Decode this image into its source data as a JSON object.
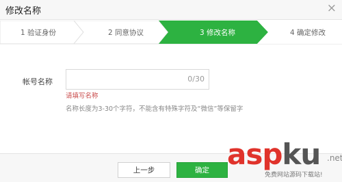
{
  "dialog": {
    "title": "修改名称",
    "close_symbol": "×"
  },
  "steps": [
    {
      "label": "1 验证身份",
      "active": false
    },
    {
      "label": "2 同意协议",
      "active": false
    },
    {
      "label": "3 修改名称",
      "active": true
    },
    {
      "label": "4 确定修改",
      "active": false
    }
  ],
  "colors": {
    "active_step": "#2db241",
    "error": "#c94a4a",
    "primary_button": "#2db241"
  },
  "form": {
    "label": "帐号名称",
    "value": "",
    "counter": "0/30",
    "error": "请填写名称",
    "hint": "名称长度为3-30个字符，不能含有特殊字符及“微信”等保留字"
  },
  "buttons": {
    "prev": "上一步",
    "ok": "确定"
  },
  "watermark": {
    "brand_red": "asp",
    "brand_gray": "ku",
    "suffix": ".net",
    "tagline": "免费网站源码下载站!"
  }
}
